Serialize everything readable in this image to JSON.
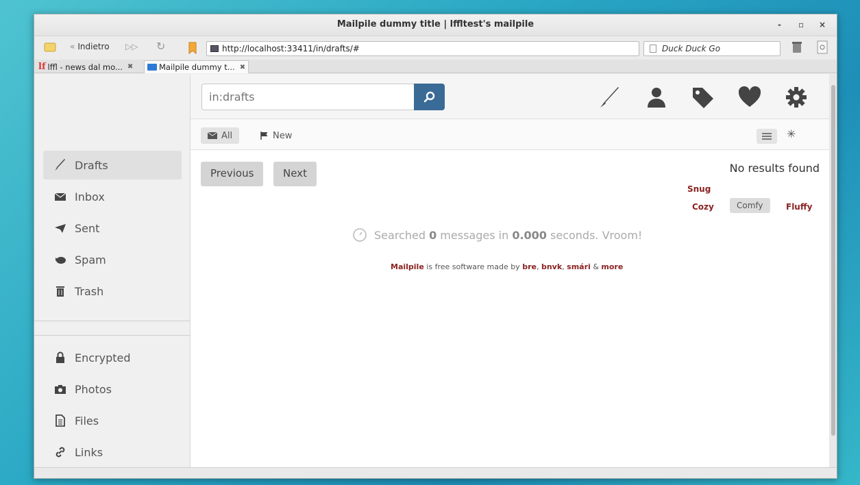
{
  "window": {
    "title": "Mailpile dummy title | lffltest's mailpile",
    "controls": {
      "minimize": "-",
      "maximize": "▫",
      "close": "×"
    }
  },
  "toolbar": {
    "back_label": "Indietro",
    "url": "http://localhost:33411/in/drafts/#",
    "search_engine": "Duck Duck Go"
  },
  "tabs": [
    {
      "label": "lffl - news dal mo...",
      "active": false
    },
    {
      "label": "Mailpile dummy t...",
      "active": true
    }
  ],
  "mailpile": {
    "search": {
      "placeholder": "in:drafts"
    },
    "nav_icons": [
      "compose-icon",
      "contacts-icon",
      "tags-icon",
      "heart-icon",
      "settings-icon"
    ],
    "sidebar_top": [
      {
        "label": "Drafts",
        "icon": "pen-icon",
        "active": true
      },
      {
        "label": "Inbox",
        "icon": "envelope-icon"
      },
      {
        "label": "Sent",
        "icon": "paper-plane-icon"
      },
      {
        "label": "Spam",
        "icon": "spam-icon"
      },
      {
        "label": "Trash",
        "icon": "trash-icon"
      }
    ],
    "sidebar_bottom": [
      {
        "label": "Encrypted",
        "icon": "lock-icon"
      },
      {
        "label": "Photos",
        "icon": "camera-icon"
      },
      {
        "label": "Files",
        "icon": "file-icon"
      },
      {
        "label": "Links",
        "icon": "link-icon"
      }
    ],
    "filters": {
      "all": "All",
      "new": "New"
    },
    "pagination": {
      "previous": "Previous",
      "next": "Next"
    },
    "no_results": "No results found",
    "density": {
      "snug": "Snug",
      "cozy": "Cozy",
      "comfy": "Comfy",
      "fluffy": "Fluffy",
      "selected": "Comfy"
    },
    "searched": {
      "prefix": "Searched",
      "count": "0",
      "middle": "messages in",
      "seconds": "0.000",
      "suffix": "seconds. Vroom!"
    },
    "credits": {
      "brand": "Mailpile",
      "text1": "is free software made by",
      "bre": "bre",
      "comma1": ",",
      "bnvk": "bnvk",
      "comma2": ",",
      "smari": "smári",
      "amp": "&",
      "more": "more"
    }
  },
  "colors": {
    "accent": "#3a6a96",
    "link": "#8b2222",
    "desktop": "#29a7c4"
  }
}
